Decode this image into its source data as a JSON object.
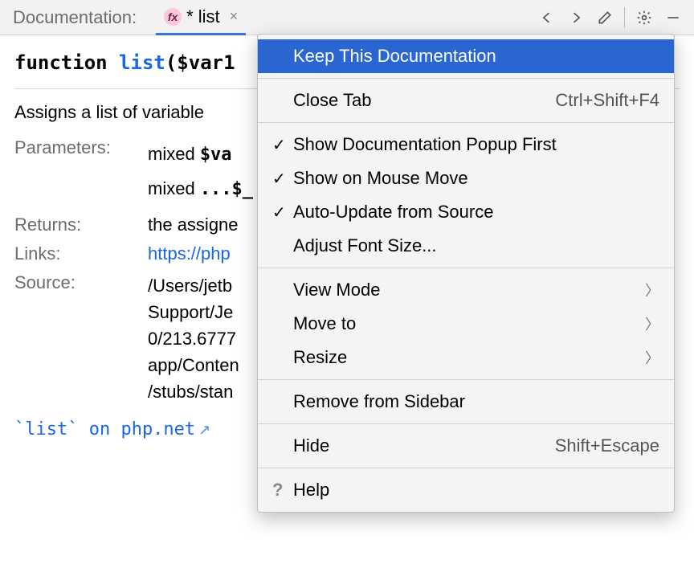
{
  "header": {
    "title": "Documentation:",
    "tab": {
      "badge": "fx",
      "label": "* list"
    }
  },
  "doc": {
    "signature": {
      "keyword": "function",
      "name": "list",
      "args_prefix": "(",
      "arg1": "$var1",
      "args_suffix_visible": ""
    },
    "description": "Assigns a list of variable",
    "labels": {
      "parameters": "Parameters:",
      "returns": "Returns:",
      "links": "Links:",
      "source": "Source:"
    },
    "params": {
      "line1_type": "mixed",
      "line1_var": "$va",
      "line2_type": "mixed",
      "line2_var": "...$_"
    },
    "returns": "the assigne",
    "link_text": "https://php",
    "source_lines": [
      "/Users/jetb",
      "Support/Je",
      "0/213.6777",
      "app/Conten",
      "/stubs/stan"
    ],
    "footer_link": "`list` on php.net"
  },
  "menu": {
    "keep": "Keep This Documentation",
    "close_tab": "Close Tab",
    "close_tab_shortcut": "Ctrl+Shift+F4",
    "show_popup": "Show Documentation Popup First",
    "show_mouse": "Show on Mouse Move",
    "auto_update": "Auto-Update from Source",
    "adjust_font": "Adjust Font Size...",
    "view_mode": "View Mode",
    "move_to": "Move to",
    "resize": "Resize",
    "remove_sidebar": "Remove from Sidebar",
    "hide": "Hide",
    "hide_shortcut": "Shift+Escape",
    "help": "Help"
  }
}
